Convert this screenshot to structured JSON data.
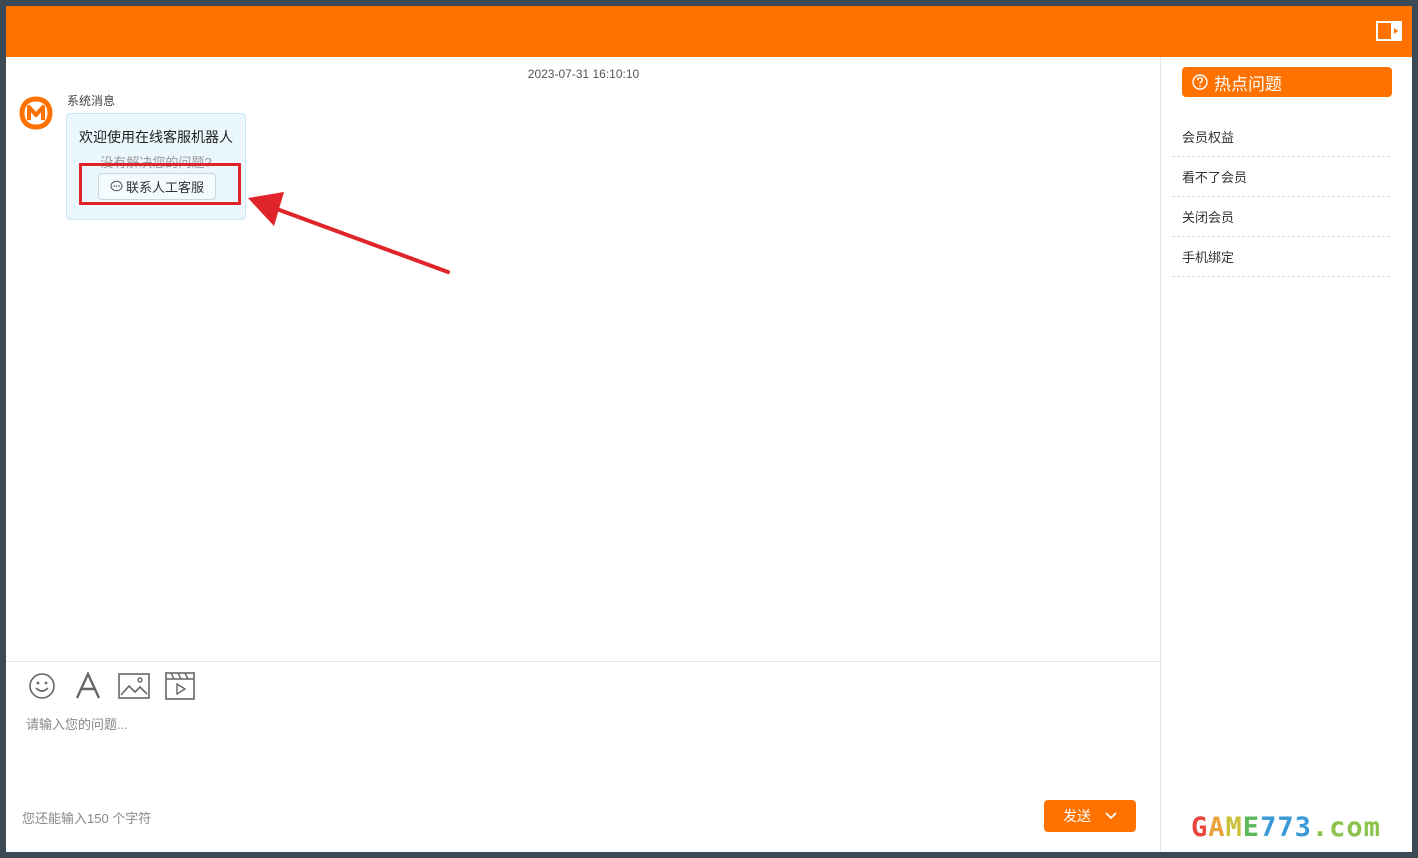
{
  "colors": {
    "accent": "#ff7200",
    "highlight": "#e0252a",
    "bubble_bg": "#eaf7fd"
  },
  "header": {
    "icon": "panel-toggle-icon"
  },
  "chat": {
    "timestamp": "2023-07-31 16:10:10",
    "sender": "系统消息",
    "avatar": "mango-tv-logo",
    "bubble": {
      "title": "欢迎使用在线客服机器人",
      "subtitle": "没有解决您的问题?",
      "contact_button": "联系人工客服"
    }
  },
  "composer": {
    "tools": [
      "emoji-icon",
      "font-icon",
      "image-icon",
      "video-icon"
    ],
    "placeholder": "请输入您的问题...",
    "counter": "您还能输入150 个字符",
    "send_label": "发送"
  },
  "sidebar": {
    "title": "热点问题",
    "items": [
      {
        "label": "会员权益"
      },
      {
        "label": "看不了会员"
      },
      {
        "label": "关闭会员"
      },
      {
        "label": "手机绑定"
      }
    ]
  },
  "watermark": {
    "parts": [
      "G",
      "A",
      "M",
      "E",
      "773",
      ".com"
    ]
  }
}
